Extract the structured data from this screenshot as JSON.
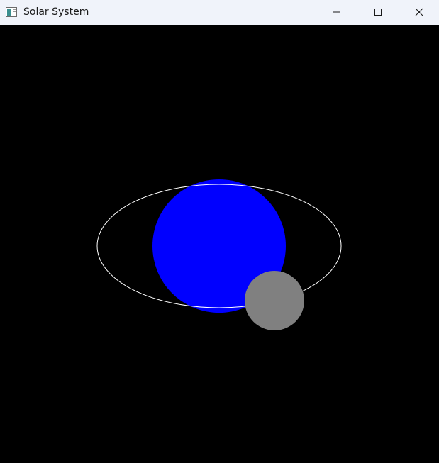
{
  "window": {
    "title": "Solar System"
  },
  "icons": {
    "app": "app-window-icon",
    "minimize": "minimize-icon",
    "maximize": "maximize-icon",
    "close": "close-icon"
  },
  "scene": {
    "background_color": "#000000",
    "orbit_color": "#ffffff",
    "planet_color": "#0000ff",
    "moon_color": "#808080"
  }
}
